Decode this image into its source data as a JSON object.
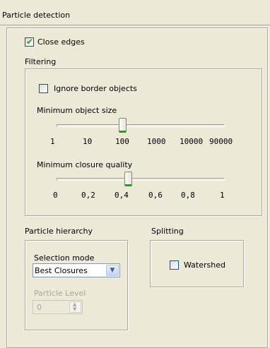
{
  "panel": {
    "title": "Particle detection",
    "close_edges": {
      "label": "Close edges",
      "checked": true
    },
    "filtering": {
      "title": "Filtering",
      "ignore_border": {
        "label": "Ignore border objects",
        "checked": false
      },
      "min_size": {
        "label": "Minimum object size",
        "ticks": [
          "1",
          "10",
          "100",
          "1000",
          "10000",
          "90000"
        ],
        "value": "100"
      },
      "min_closure": {
        "label": "Minimum closure quality",
        "ticks": [
          "0",
          "0,2",
          "0,4",
          "0,6",
          "0,8",
          "1"
        ],
        "value": "0,4"
      }
    },
    "hierarchy": {
      "title": "Particle hierarchy",
      "selection_mode_label": "Selection mode",
      "selection_mode_value": "Best Closures",
      "particle_level_label": "Particle Level",
      "particle_level_value": "0"
    },
    "splitting": {
      "title": "Splitting",
      "watershed": {
        "label": "Watershed",
        "checked": false
      }
    }
  },
  "colors": {
    "check": "#21a121",
    "background": "#ece9d8"
  }
}
